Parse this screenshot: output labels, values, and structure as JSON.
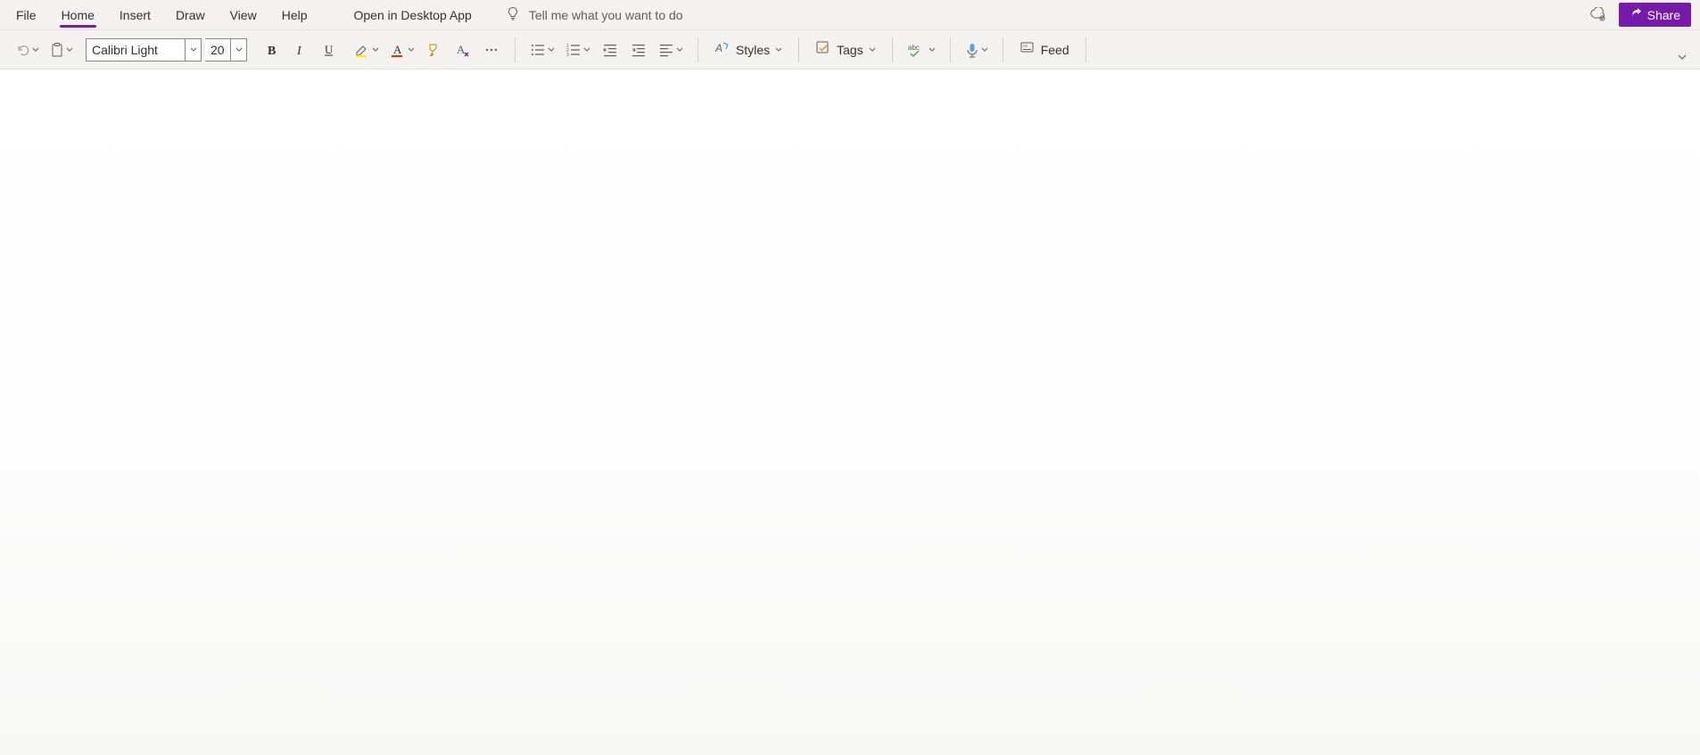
{
  "tabs": {
    "file": "File",
    "home": "Home",
    "insert": "Insert",
    "draw": "Draw",
    "view": "View",
    "help": "Help",
    "active": "home"
  },
  "header": {
    "open_desktop": "Open in Desktop App",
    "search_placeholder": "Tell me what you want to do",
    "share": "Share"
  },
  "ribbon": {
    "font_name": "Calibri Light",
    "font_size": "20",
    "styles": "Styles",
    "tags": "Tags",
    "feed": "Feed"
  }
}
